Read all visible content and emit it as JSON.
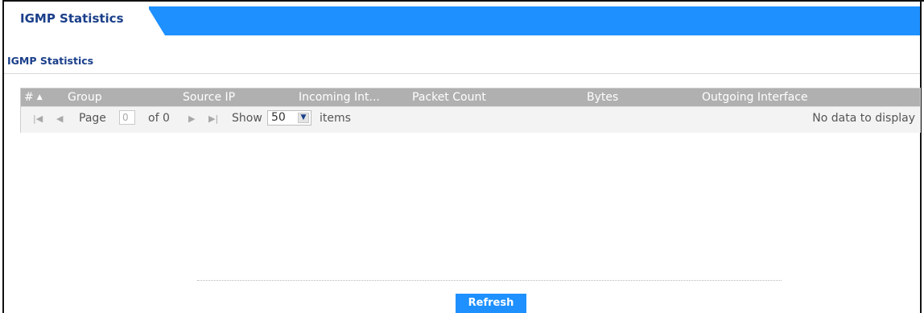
{
  "tabs": [
    {
      "label": "IGMP Statistics",
      "active": true
    }
  ],
  "section": {
    "title": "IGMP Statistics"
  },
  "table": {
    "columns": [
      "#",
      "Group",
      "Source IP",
      "Incoming Int...",
      "Packet Count",
      "Bytes",
      "Outgoing Interface"
    ],
    "sort_column": "#",
    "sort_direction": "ascending",
    "rows": []
  },
  "pager": {
    "page_label": "Page",
    "page_value": "0",
    "of_label": "of 0",
    "show_label": "Show",
    "items_per_page": "50",
    "items_label": "items",
    "empty_message": "No data to display"
  },
  "buttons": {
    "refresh_label": "Refresh"
  },
  "icons": {
    "first_page": "first-page-icon",
    "prev_page": "prev-page-icon",
    "next_page": "next-page-icon",
    "last_page": "last-page-icon",
    "dropdown": "chevron-down-icon",
    "sort": "sort-ascending-icon"
  },
  "colors": {
    "accent": "#1e90ff",
    "title_text": "#1a3f8a",
    "header_bg": "#b0b0b0",
    "pager_bg": "#f3f3f3"
  }
}
